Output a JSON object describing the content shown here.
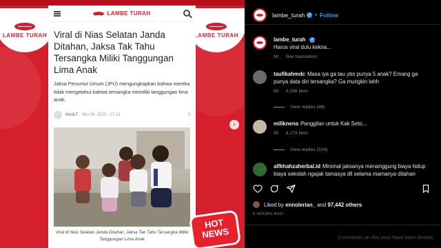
{
  "article": {
    "brand": "LAMBE TURAH",
    "title": "Viral di Nias Selatan Janda Ditahan, Jaksa Tak Tahu Tersangka Miliki Tanggungan Lima Anak",
    "lead": "Jaksa Penuntut Umum (JPU) mengungkapkan bahwa mereka tidak mengetahui bahwa tersangka memiliki tanggungan lima anak.",
    "author": "ModLT",
    "date": "Mei 26, 2023 - 17:13",
    "comment_count": "0",
    "caption": "Viral di Nias Selatan Janda Ditahan, Jaksa Tak Tahu Tersangka Miliki Tanggungan Lima Anak"
  },
  "background": {
    "logo_text": "LAMBE TURAH",
    "badge_line1": "HOT",
    "badge_line2": "NEWS"
  },
  "post": {
    "username": "lambe_turah",
    "follow_label": "Follow",
    "caption_user": "lambe_turah",
    "caption_text": "Harus viral dulu kekna...",
    "caption_time": "5h",
    "see_translation": "See translation",
    "comments": [
      {
        "user": "taufikahmdc",
        "text": "Masa iya ga tau ybs punya 5 anak? Emang ga punya data diri tersangka? Ga mungkin lahh",
        "time": "5h",
        "likes": "4,158 likes",
        "replies": "View replies (46)"
      },
      {
        "user": "miliknena",
        "text": "Panggilan untuk Kak Seto...",
        "time": "5h",
        "likes": "4,174 likes",
        "replies": "View replies (316)"
      },
      {
        "user": "alfkhahzaherbal.id",
        "text": "Minimal jaksanya menanggung biaya hidup biaya sekolah ngajak tamasya dll selama mamanya ditahan",
        "time": "",
        "likes": "",
        "replies": ""
      }
    ],
    "liked_by_prefix": "Liked by",
    "liked_by_user": "ennolerian_",
    "liked_by_and": "and",
    "likes_count": "97,442 others",
    "time_ago": "5 HOURS AGO",
    "comments_limited": "Comments on this post have been limited."
  },
  "colors": {
    "brand_red": "#d61f2d",
    "link_blue": "#3897f0",
    "dark_bg": "#000000"
  },
  "icons": [
    "menu-icon",
    "search-icon",
    "heart-icon",
    "comment-icon",
    "share-icon",
    "bookmark-icon",
    "verified-icon",
    "chevron-right-icon"
  ]
}
